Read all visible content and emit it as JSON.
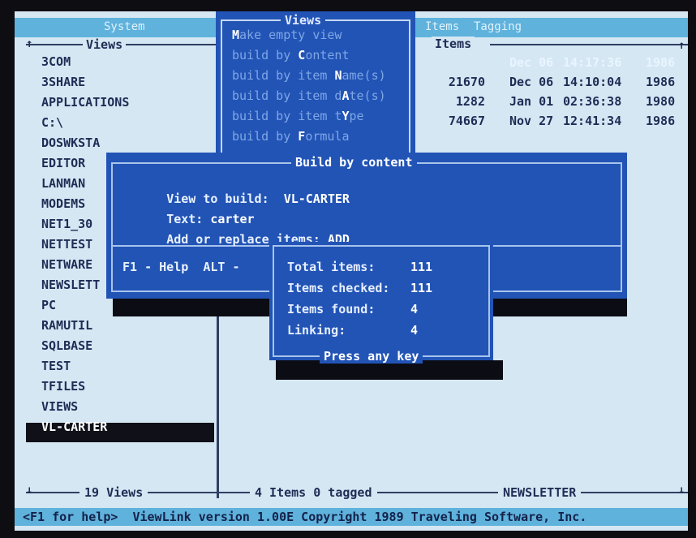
{
  "menubar": {
    "system": "System",
    "views": "Views",
    "items": "Items",
    "tagging": "Tagging"
  },
  "left_panel": {
    "title": "Views",
    "items": [
      "3COM",
      "3SHARE",
      "APPLICATIONS",
      "C:\\",
      "DOSWKSTA",
      "EDITOR",
      "LANMAN",
      "MODEMS",
      "NET1_30",
      "NETTEST",
      "NETWARE",
      "NEWSLETT",
      "PC",
      "RAMUTIL",
      "SQLBASE",
      "TEST",
      "TFILES",
      "VIEWS",
      "VL-CARTER"
    ],
    "selected": "VL-CARTER",
    "count_label": "19 Views"
  },
  "views_menu": {
    "items": [
      {
        "pre": "",
        "hot": "M",
        "post": "ake empty view"
      },
      {
        "pre": "build by ",
        "hot": "C",
        "post": "ontent"
      },
      {
        "pre": "build by item ",
        "hot": "N",
        "post": "ame(s)"
      },
      {
        "pre": "build by item d",
        "hot": "A",
        "post": "te(s)"
      },
      {
        "pre": "build by item t",
        "hot": "Y",
        "post": "pe"
      },
      {
        "pre": "build by ",
        "hot": "F",
        "post": "ormula"
      }
    ]
  },
  "right_panel": {
    "title": "Items",
    "rows": [
      {
        "size": "",
        "date": "Dec 06",
        "time": "14:17:36",
        "year": "1986"
      },
      {
        "size": "21670",
        "date": "Dec 06",
        "time": "14:10:04",
        "year": "1986"
      },
      {
        "size": "1282",
        "date": "Jan 01",
        "time": "02:36:38",
        "year": "1980"
      },
      {
        "size": "74667",
        "date": "Nov 27",
        "time": "12:41:34",
        "year": "1986"
      }
    ],
    "tag_label": "4 Items 0 tagged",
    "view_name": "NEWSLETTER"
  },
  "dialog": {
    "title": "Build by content",
    "view_label": "View to build:",
    "view_value": "VL-CARTER",
    "text_label": "Text:",
    "text_value": "carter",
    "mode_label": "Add or replace items:",
    "mode_value": "ADD",
    "help_hint": "F1 - Help  ALT -"
  },
  "popup": {
    "total_label": "Total items:",
    "total_value": "111",
    "checked_label": "Items checked:",
    "checked_value": "111",
    "found_label": "Items found:",
    "found_value": "4",
    "linking_label": "Linking:",
    "linking_value": "4",
    "footer": "Press any key"
  },
  "status_bar": {
    "text": "<F1 for help>  ViewLink version 1.00E Copyright 1989 Traveling Software, Inc."
  },
  "colors": {
    "screen_bg": "#d5e7f3",
    "menubar_bg": "#5fb2dc",
    "dialog_bg": "#2254b6",
    "text_dark": "#1f2c55"
  }
}
